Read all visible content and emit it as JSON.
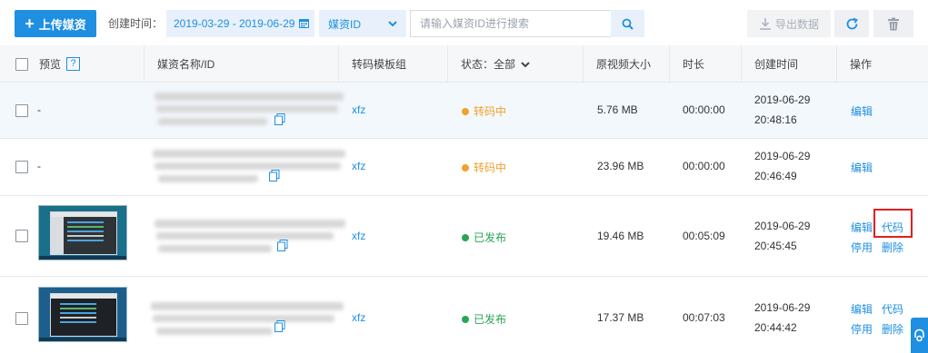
{
  "toolbar": {
    "upload_label": "上传媒资",
    "created_time_label": "创建时间：",
    "date_range": "2019-03-29 - 2019-06-29",
    "select_value": "媒资ID",
    "search_placeholder": "请输入媒资ID进行搜索",
    "export_label": "导出数据"
  },
  "table": {
    "headers": {
      "preview": "预览",
      "help": "?",
      "name": "媒资名称/ID",
      "template": "转码模板组",
      "status": "状态：全部",
      "size": "原视频大小",
      "duration": "时长",
      "created": "创建时间",
      "actions": "操作"
    },
    "rows": [
      {
        "preview": "-",
        "template": "xfz",
        "status": "转码中",
        "size": "5.76 MB",
        "duration": "00:00:00",
        "date": "2019-06-29",
        "time": "20:48:16",
        "actions": [
          "编辑"
        ]
      },
      {
        "preview": "-",
        "template": "xfz",
        "status": "转码中",
        "size": "23.96 MB",
        "duration": "00:00:00",
        "date": "2019-06-29",
        "time": "20:46:49",
        "actions": [
          "编辑"
        ]
      },
      {
        "preview": "",
        "template": "xfz",
        "status": "已发布",
        "size": "19.46 MB",
        "duration": "00:05:09",
        "date": "2019-06-29",
        "time": "20:45:45",
        "actions": [
          "编辑",
          "代码",
          "停用",
          "删除"
        ]
      },
      {
        "preview": "",
        "template": "xfz",
        "status": "已发布",
        "size": "17.37 MB",
        "duration": "00:07:03",
        "date": "2019-06-29",
        "time": "20:44:42",
        "actions": [
          "编辑",
          "代码",
          "停用",
          "删除"
        ]
      }
    ]
  },
  "colors": {
    "accent": "#1e8fe1",
    "status_transcoding": "#f1a02c",
    "status_published": "#2aa556",
    "highlight": "#e02020"
  },
  "icons": {
    "upload": "plus-icon",
    "date": "calendar-icon",
    "select": "chevron-down-icon",
    "search": "search-icon",
    "export": "download-icon",
    "refresh": "refresh-icon",
    "delete": "trash-icon",
    "copy": "copy-icon",
    "side_tab": "service-icon"
  }
}
